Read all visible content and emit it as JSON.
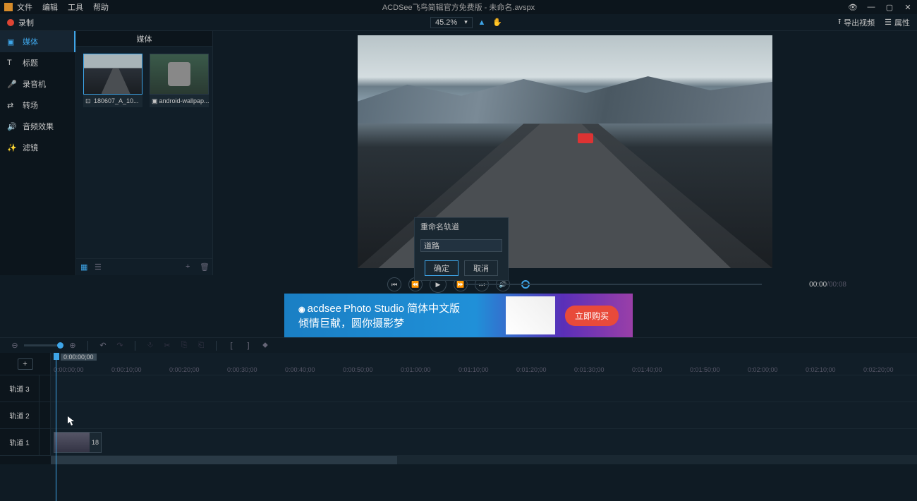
{
  "titlebar": {
    "menu": [
      "文件",
      "编辑",
      "工具",
      "帮助"
    ],
    "title": "ACDSee飞鸟简辑官方免费版 - 未命名.avspx"
  },
  "toolbar": {
    "record": "录制",
    "zoom": "45.2%",
    "export": "导出视频",
    "properties": "属性"
  },
  "sidebar": {
    "items": [
      {
        "label": "媒体",
        "icon": "media-icon"
      },
      {
        "label": "标题",
        "icon": "text-icon"
      },
      {
        "label": "录音机",
        "icon": "mic-icon"
      },
      {
        "label": "转场",
        "icon": "transition-icon"
      },
      {
        "label": "音频效果",
        "icon": "audio-icon"
      },
      {
        "label": "滤镜",
        "icon": "filter-icon"
      }
    ]
  },
  "media": {
    "tab": "媒体",
    "clips": [
      {
        "name": "180607_A_10..."
      },
      {
        "name": "android-wallpap..."
      }
    ]
  },
  "playback": {
    "current": "00:00",
    "total": "/00:08"
  },
  "ad": {
    "brand": "acdsee",
    "line1": "Photo Studio 简体中文版",
    "line2": "倾情巨献，圆你摄影梦",
    "cta": "立即购买"
  },
  "timeline": {
    "playhead": "0:00:00;00",
    "ticks": [
      "0:00:00;00",
      "0:00:10;00",
      "0:00:20;00",
      "0:00:30;00",
      "0:00:40;00",
      "0:00:50;00",
      "0:01:00;00",
      "0:01:10;00",
      "0:01:20;00",
      "0:01:30;00",
      "0:01:40;00",
      "0:01:50;00",
      "0:02:00;00",
      "0:02:10;00",
      "0:02:20;00"
    ],
    "tracks": [
      "轨道 3",
      "轨道 2",
      "轨道 1"
    ],
    "clip_end": "18"
  },
  "dialog": {
    "title": "重命名轨道",
    "value": "道路",
    "ok": "确定",
    "cancel": "取消"
  }
}
